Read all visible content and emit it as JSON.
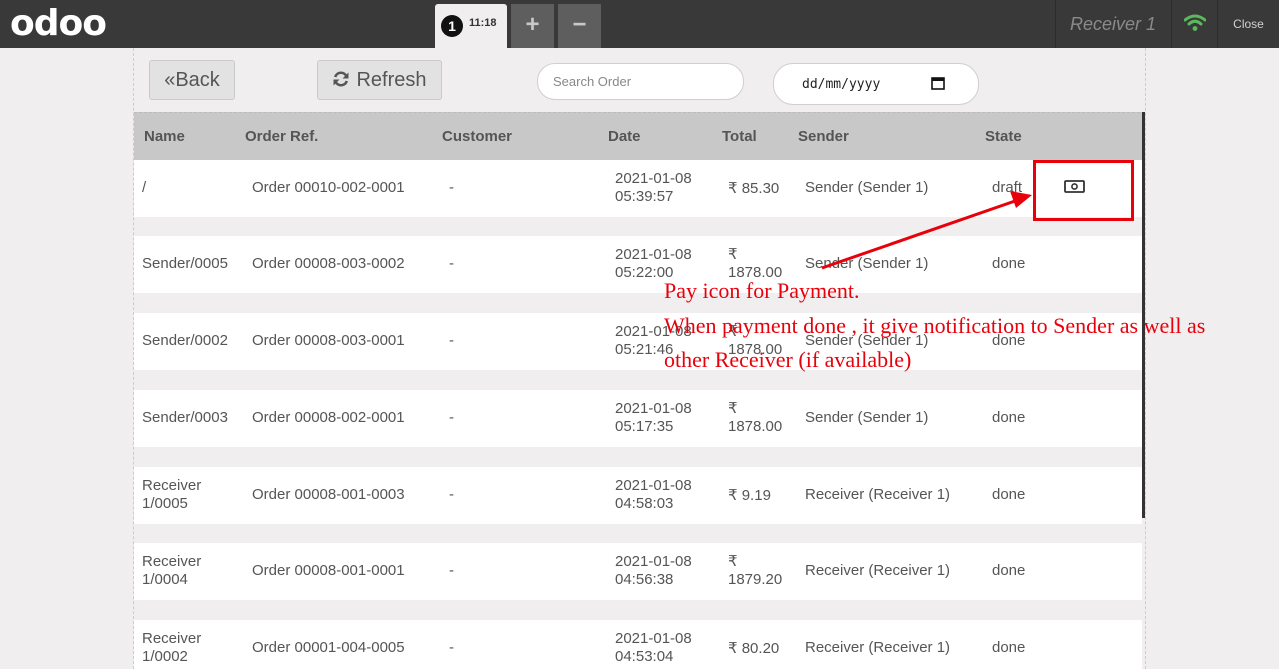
{
  "header": {
    "logo_text": "odoo",
    "order_tab": {
      "number": "1",
      "time": "11:18"
    },
    "add_order_symbol": "+",
    "remove_order_symbol": "−",
    "cashier": "Receiver 1",
    "close_label": "Close"
  },
  "controls": {
    "back_label": "Back",
    "back_icon": "double-chevron-left",
    "refresh_label": "Refresh",
    "refresh_icon": "refresh",
    "search_placeholder": "Search Order",
    "date_value": "dd/mm/yyyy"
  },
  "table": {
    "headers": [
      "Name",
      "Order Ref.",
      "Customer",
      "Date",
      "Total",
      "Sender",
      "State"
    ],
    "rows": [
      {
        "name": "/",
        "ref": "Order 00010-002-0001",
        "customer": "-",
        "date1": "2021-01-08",
        "date2": "05:39:57",
        "total1": "₹ 85.30",
        "total2": "",
        "sender": "Sender (Sender 1)",
        "state": "draft",
        "pay": true
      },
      {
        "name": "Sender/0005",
        "ref": "Order 00008-003-0002",
        "customer": "-",
        "date1": "2021-01-08",
        "date2": "05:22:00",
        "total1": "₹",
        "total2": "1878.00",
        "sender": "Sender (Sender 1)",
        "state": "done",
        "pay": false
      },
      {
        "name": "Sender/0002",
        "ref": "Order 00008-003-0001",
        "customer": "-",
        "date1": "2021-01-08",
        "date2": "05:21:46",
        "total1": "₹",
        "total2": "1878.00",
        "sender": "Sender (Sender 1)",
        "state": "done",
        "pay": false
      },
      {
        "name": "Sender/0003",
        "ref": "Order 00008-002-0001",
        "customer": "-",
        "date1": "2021-01-08",
        "date2": "05:17:35",
        "total1": "₹",
        "total2": "1878.00",
        "sender": "Sender (Sender 1)",
        "state": "done",
        "pay": false
      },
      {
        "name": "Receiver",
        "name2": "1/0005",
        "ref": "Order 00008-001-0003",
        "customer": "-",
        "date1": "2021-01-08",
        "date2": "04:58:03",
        "total1": "₹ 9.19",
        "total2": "",
        "sender": "Receiver (Receiver 1)",
        "state": "done",
        "pay": false
      },
      {
        "name": "Receiver",
        "name2": "1/0004",
        "ref": "Order 00008-001-0001",
        "customer": "-",
        "date1": "2021-01-08",
        "date2": "04:56:38",
        "total1": "₹",
        "total2": "1879.20",
        "sender": "Receiver (Receiver 1)",
        "state": "done",
        "pay": false
      },
      {
        "name": "Receiver",
        "name2": "1/0002",
        "ref": "Order 00001-004-0005",
        "customer": "-",
        "date1": "2021-01-08",
        "date2": "04:53:04",
        "total1": "₹ 80.20",
        "total2": "",
        "sender": "Receiver (Receiver 1)",
        "state": "done",
        "pay": false
      }
    ],
    "pay_icon": "money-icon"
  },
  "annotation": {
    "line1": "Pay icon for Payment.",
    "line2": "When payment done , it give notification to Sender as well as",
    "line3": "other Receiver (if available)",
    "color": "#e8000b"
  }
}
